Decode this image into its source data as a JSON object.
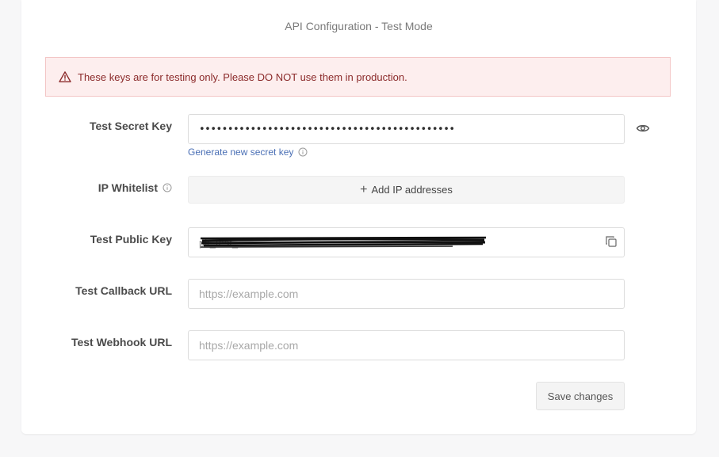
{
  "page": {
    "title": "API Configuration - Test Mode"
  },
  "alert": {
    "message": "These keys are for testing only. Please DO NOT use them in production.",
    "icon": "warning-triangle-icon",
    "color": "#8b2a2a"
  },
  "fields": {
    "secret_key": {
      "label": "Test Secret Key",
      "value": "•••••••••••••••••••••••••••••••••••••••••••••",
      "generate_link": "Generate new secret key",
      "toggle_icon": "eye-icon"
    },
    "ip_whitelist": {
      "label": "IP Whitelist",
      "add_button": "Add IP addresses"
    },
    "public_key": {
      "label": "Test Public Key",
      "value": "pk_test_",
      "copy_icon": "copy-icon"
    },
    "callback_url": {
      "label": "Test Callback URL",
      "placeholder": "https://example.com",
      "value": ""
    },
    "webhook_url": {
      "label": "Test Webhook URL",
      "placeholder": "https://example.com",
      "value": ""
    }
  },
  "actions": {
    "save_label": "Save changes"
  },
  "colors": {
    "link": "#4a6fb5",
    "alert_bg": "#fdeeee",
    "alert_border": "#f3c6c6"
  }
}
